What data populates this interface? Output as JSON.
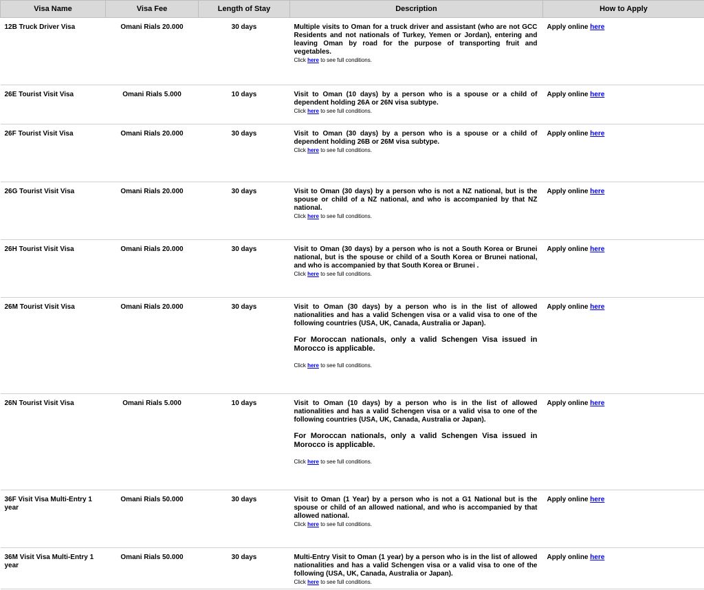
{
  "headers": [
    "Visa Name",
    "Visa Fee",
    "Length of Stay",
    "Description",
    "How to Apply"
  ],
  "apply_prefix": "Apply online",
  "link_text": "here",
  "click_prefix": "Click",
  "click_suffix": "to see full conditions.",
  "rows": [
    {
      "name": "12B Truck Driver Visa",
      "fee": "Omani Rials 20.000",
      "stay": "30 days",
      "desc": "Multiple visits to Oman for a truck driver and assistant (who are not GCC Residents and not nationals of Turkey, Yemen or Jordan), entering and leaving Oman by road for the purpose of transporting fruit and vegetables.",
      "note": ""
    },
    {
      "name": "26E Tourist Visit Visa",
      "fee": "Omani Rials 5.000",
      "stay": "10 days",
      "desc": "Visit to Oman (10 days) by a person who is a spouse or a child of dependent holding 26A or 26N visa subtype.",
      "note": ""
    },
    {
      "name": "26F Tourist Visit Visa",
      "fee": "Omani Rials 20.000",
      "stay": "30 days",
      "desc": "Visit to Oman (30 days) by a person who is a spouse or a child of dependent holding 26B or 26M visa subtype.",
      "note": ""
    },
    {
      "name": "26G Tourist Visit Visa",
      "fee": "Omani Rials 20.000",
      "stay": "30 days",
      "desc": "Visit to Oman (30 days) by a person who is not a NZ national, but is the spouse or child of a NZ national, and who is accompanied by that NZ national.",
      "note": ""
    },
    {
      "name": "26H Tourist Visit Visa",
      "fee": "Omani Rials 20.000",
      "stay": "30 days",
      "desc": "Visit to Oman (30 days) by a person who is not a South Korea or Brunei national, but is the spouse or child of a South Korea or Brunei national, and who is accompanied by that South Korea or Brunei .",
      "note": ""
    },
    {
      "name": "26M Tourist Visit Visa",
      "fee": "Omani Rials 20.000",
      "stay": "30 days",
      "desc": "Visit to Oman (30 days) by a person who is in the list of allowed nationalities and has a valid Schengen visa or a valid visa to one of the following countries (USA, UK, Canada, Australia or Japan).",
      "note": "For Moroccan nationals, only a valid Schengen Visa issued in Morocco is applicable."
    },
    {
      "name": "26N Tourist Visit Visa",
      "fee": "Omani Rials 5.000",
      "stay": "10 days",
      "desc": "Visit to Oman (10 days) by a person who is in the list of allowed nationalities and has a valid Schengen visa or a valid visa to one of the following countries (USA, UK, Canada, Australia or Japan).",
      "note": "For Moroccan nationals, only a valid Schengen Visa issued in Morocco is applicable."
    },
    {
      "name": "36F Visit Visa Multi-Entry 1 year",
      "fee": "Omani Rials 50.000",
      "stay": "30 days",
      "desc": "Visit to Oman (1 Year) by a person who is not a G1 National but is the spouse or child of an allowed national, and who is accompanied by that allowed national.",
      "note": ""
    },
    {
      "name": "36M Visit Visa Multi-Entry 1 year",
      "fee": "Omani Rials 50.000",
      "stay": "30 days",
      "desc": "Multi-Entry Visit to Oman (1 year) by a person who is in the list of allowed nationalities and has a valid Schengen visa or a valid visa to one of the following (USA, UK, Canada, Australia or Japan).",
      "note": ""
    }
  ]
}
